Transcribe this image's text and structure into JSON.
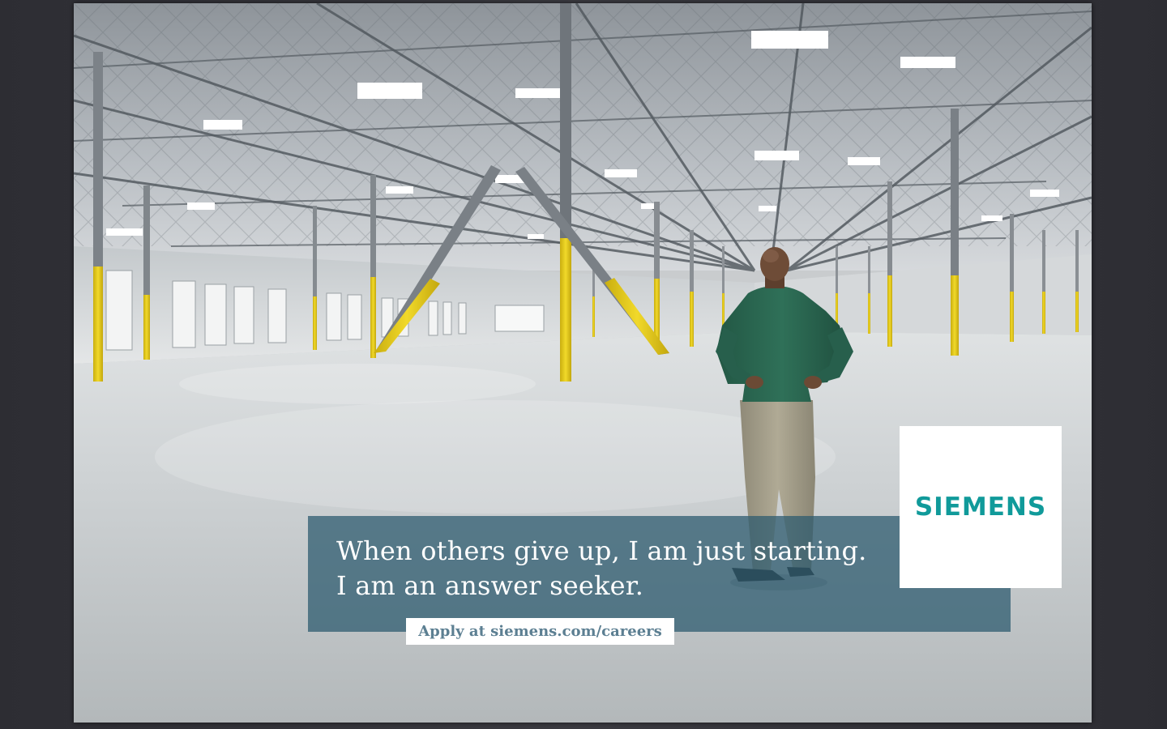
{
  "ad": {
    "headline_line1": "When others give up, I am just starting.",
    "headline_line2": "I am an answer seeker.",
    "apply_text": "Apply at siemens.com/careers",
    "logo_text": "SIEMENS"
  },
  "colors": {
    "page_background": "#35353b",
    "headline_box": "#2c5a6e",
    "logo_teal": "#109a9a",
    "apply_text": "#5c7f92",
    "column_yellow": "#e8cf1c",
    "shirt_green": "#2d6a55",
    "trousers_khaki": "#a49e8a"
  },
  "scene": {
    "description_icon": "warehouse-photo",
    "person_icon": "man-standing-hands-on-hips"
  }
}
